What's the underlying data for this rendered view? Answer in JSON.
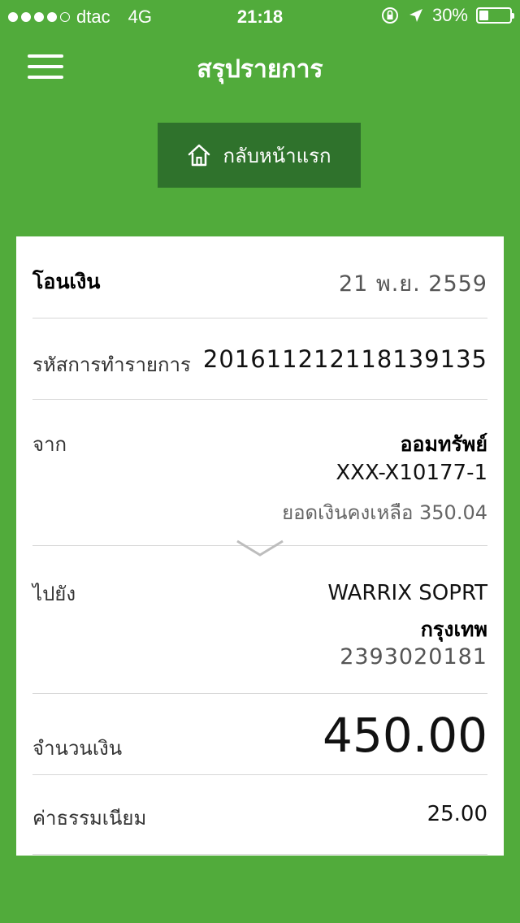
{
  "status_bar": {
    "carrier": "dtac",
    "network": "4G",
    "time": "21:18",
    "battery": "30%",
    "battery_level": 0.3
  },
  "nav": {
    "title": "สรุปรายการ",
    "menu_icon": "menu-icon"
  },
  "home_button": {
    "label": "กลับหน้าแรก",
    "icon": "home-icon"
  },
  "summary": {
    "transaction_type": "โอนเงิน",
    "date": "21 พ.ย. 2559",
    "reference_label": "รหัสการทำรายการ",
    "reference_value": "201611212118139135",
    "from_label": "จาก",
    "from_account_name": "ออมทรัพย์",
    "from_account_number": "XXX-X10177-1",
    "from_balance": "ยอดเงินคงเหลือ 350.04",
    "to_label": "ไปยัง",
    "to_name": "WARRIX SOPRT",
    "to_bank": "กรุงเทพ",
    "to_account_number": "2393020181",
    "amount_label": "จำนวนเงิน",
    "amount_value": "450.00",
    "fee_label": "ค่าธรรมเนียม",
    "fee_value": "25.00"
  },
  "colors": {
    "background": "#51ab3b",
    "button": "#2f722c",
    "card": "#ffffff"
  }
}
